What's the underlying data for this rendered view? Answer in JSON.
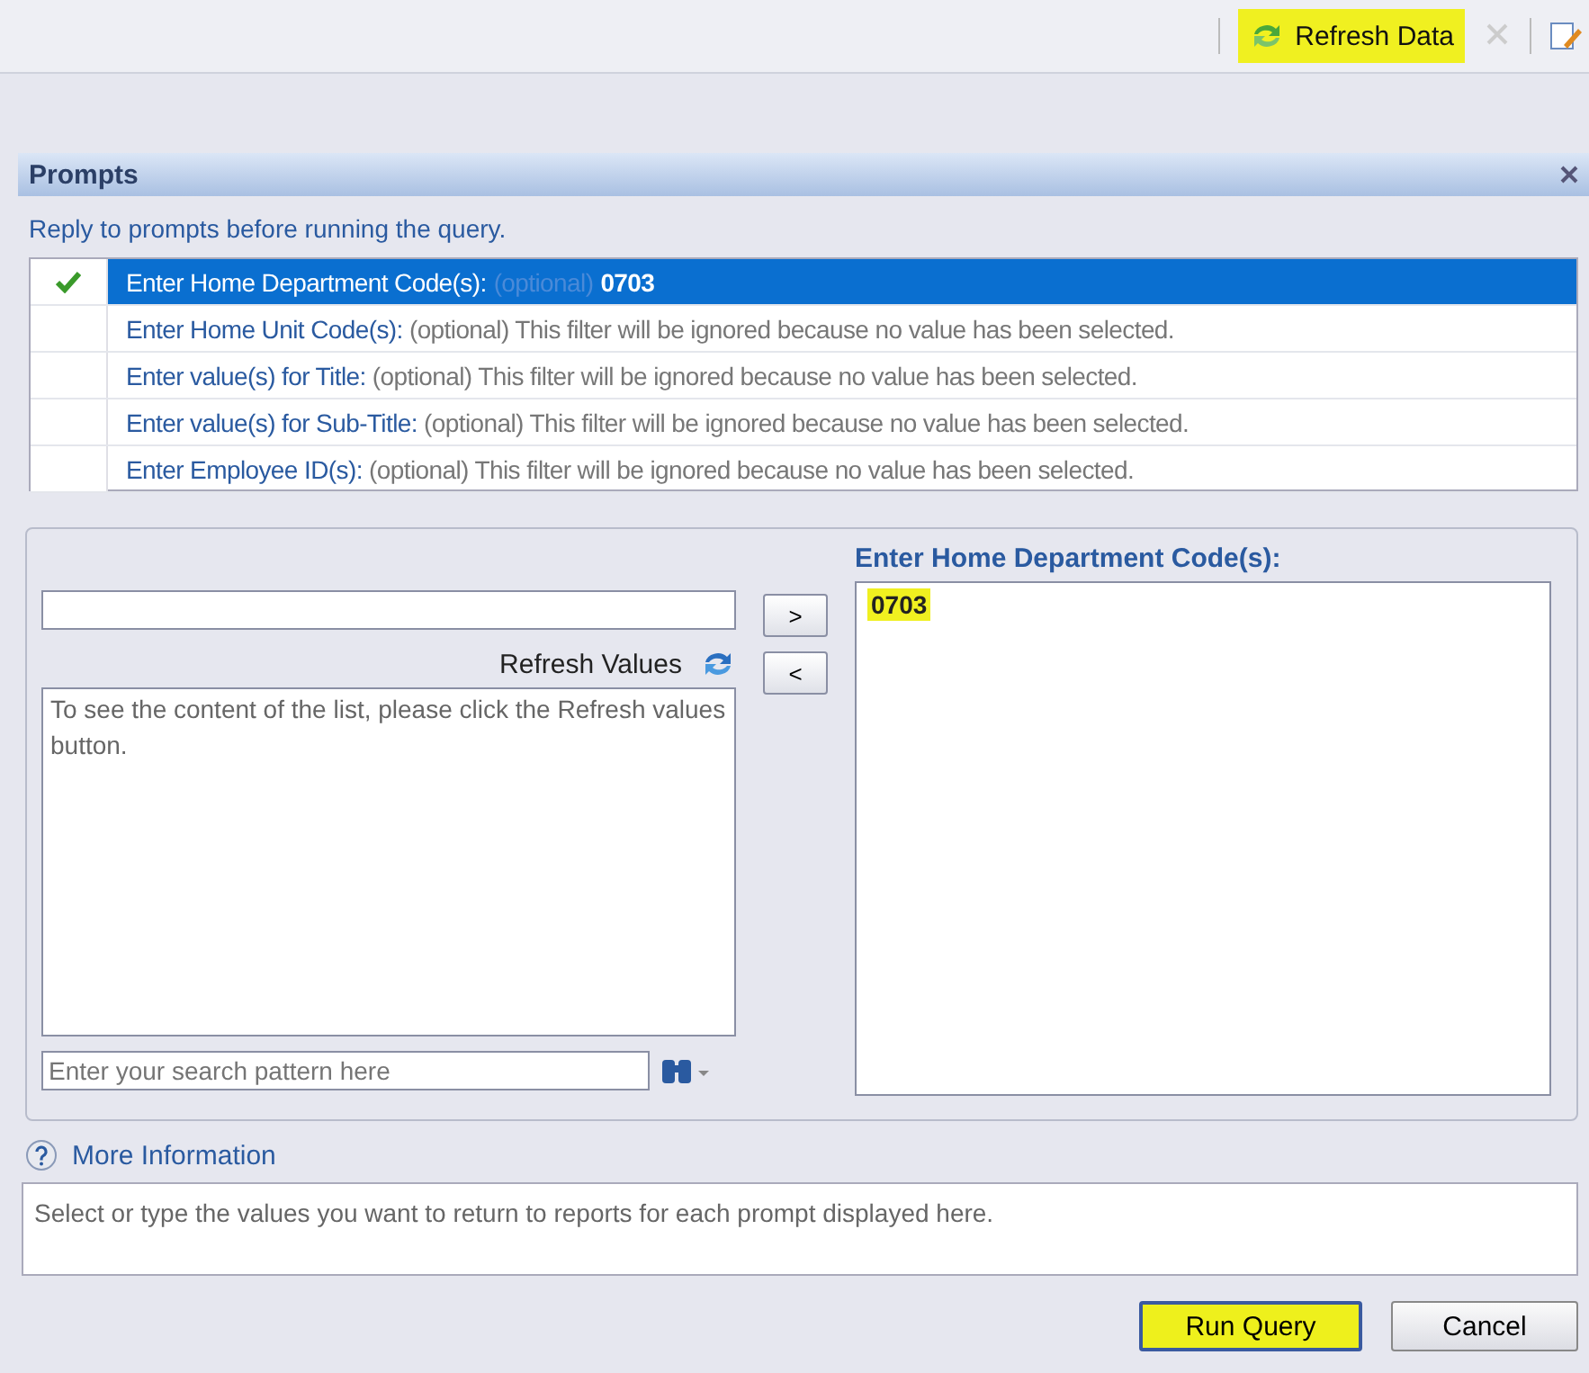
{
  "toolbar": {
    "refresh": {
      "label": "Refresh Data",
      "highlighted": true
    }
  },
  "panel": {
    "title": "Prompts",
    "instruction": "Reply to prompts before running the query."
  },
  "prompts": [
    {
      "label": "Enter Home Department Code(s):",
      "optional": "(optional)",
      "note": "0703",
      "checked": true,
      "selected": true
    },
    {
      "label": "Enter Home Unit Code(s):",
      "optional": "(optional)",
      "note": "This filter will be ignored because no value has been selected.",
      "checked": false,
      "selected": false
    },
    {
      "label": "Enter value(s) for Title:",
      "optional": "(optional)",
      "note": "This filter will be ignored because no value has been selected.",
      "checked": false,
      "selected": false
    },
    {
      "label": "Enter value(s) for Sub-Title:",
      "optional": "(optional)",
      "note": "This filter will be ignored because no value has been selected.",
      "checked": false,
      "selected": false
    },
    {
      "label": "Enter Employee ID(s):",
      "optional": "(optional)",
      "note": "This filter will be ignored because no value has been selected.",
      "checked": false,
      "selected": false
    }
  ],
  "editor": {
    "add_button": ">",
    "remove_button": "<",
    "refresh_values": "Refresh Values",
    "list_message": "To see the content of the list, please click the Refresh values button.",
    "search": {
      "placeholder": "Enter your search pattern here"
    },
    "selected_title": "Enter Home Department Code(s):",
    "selected_values": [
      {
        "text": "0703",
        "highlighted": true
      }
    ]
  },
  "more_information": {
    "label": "More Information",
    "text": "Select or type the values you want to return to reports for each prompt displayed here."
  },
  "buttons": [
    {
      "label": "Run Query",
      "kind": "primary",
      "highlighted": true
    },
    {
      "label": "Cancel",
      "kind": "secondary",
      "highlighted": false
    }
  ]
}
